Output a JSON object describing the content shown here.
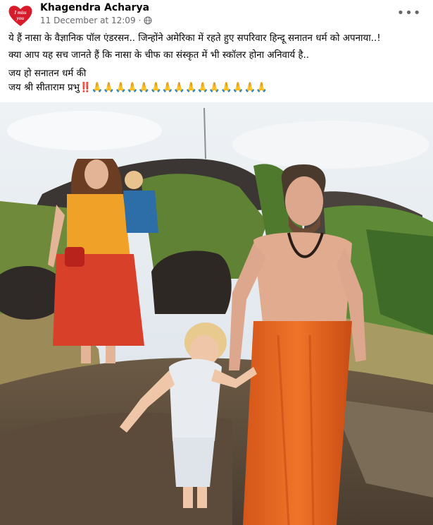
{
  "post": {
    "author": "Khagendra Acharya",
    "date": "11 December at 12:09",
    "privacy_icon": "globe-icon",
    "more_icon": "more-options-icon",
    "avatar_text_line1": "I miss",
    "avatar_text_line2": "you",
    "lines": [
      "ये हैं नासा के वैज्ञानिक पॉल एंडरसन.. जिन्होंने अमेरिका में रहते हुए सपरिवार हिन्दू सनातन धर्म को अपनाया..!",
      "क्या आप यह सच जानते हैं कि नासा के चीफ का संस्कृत में भी स्कॉलर होना अनिवार्य है..",
      "जय हो सनातन धर्म की",
      "जय श्री सीताराम प्रभु‼️🙏🙏🙏🙏🙏🙏🙏🙏🙏🙏🙏🙏🙏🙏🙏"
    ]
  },
  "colors": {
    "avatar_red": "#d81b2a",
    "meta_gray": "#65676b",
    "robe_orange": "#e8641b",
    "sky": "#dfe7ee"
  }
}
